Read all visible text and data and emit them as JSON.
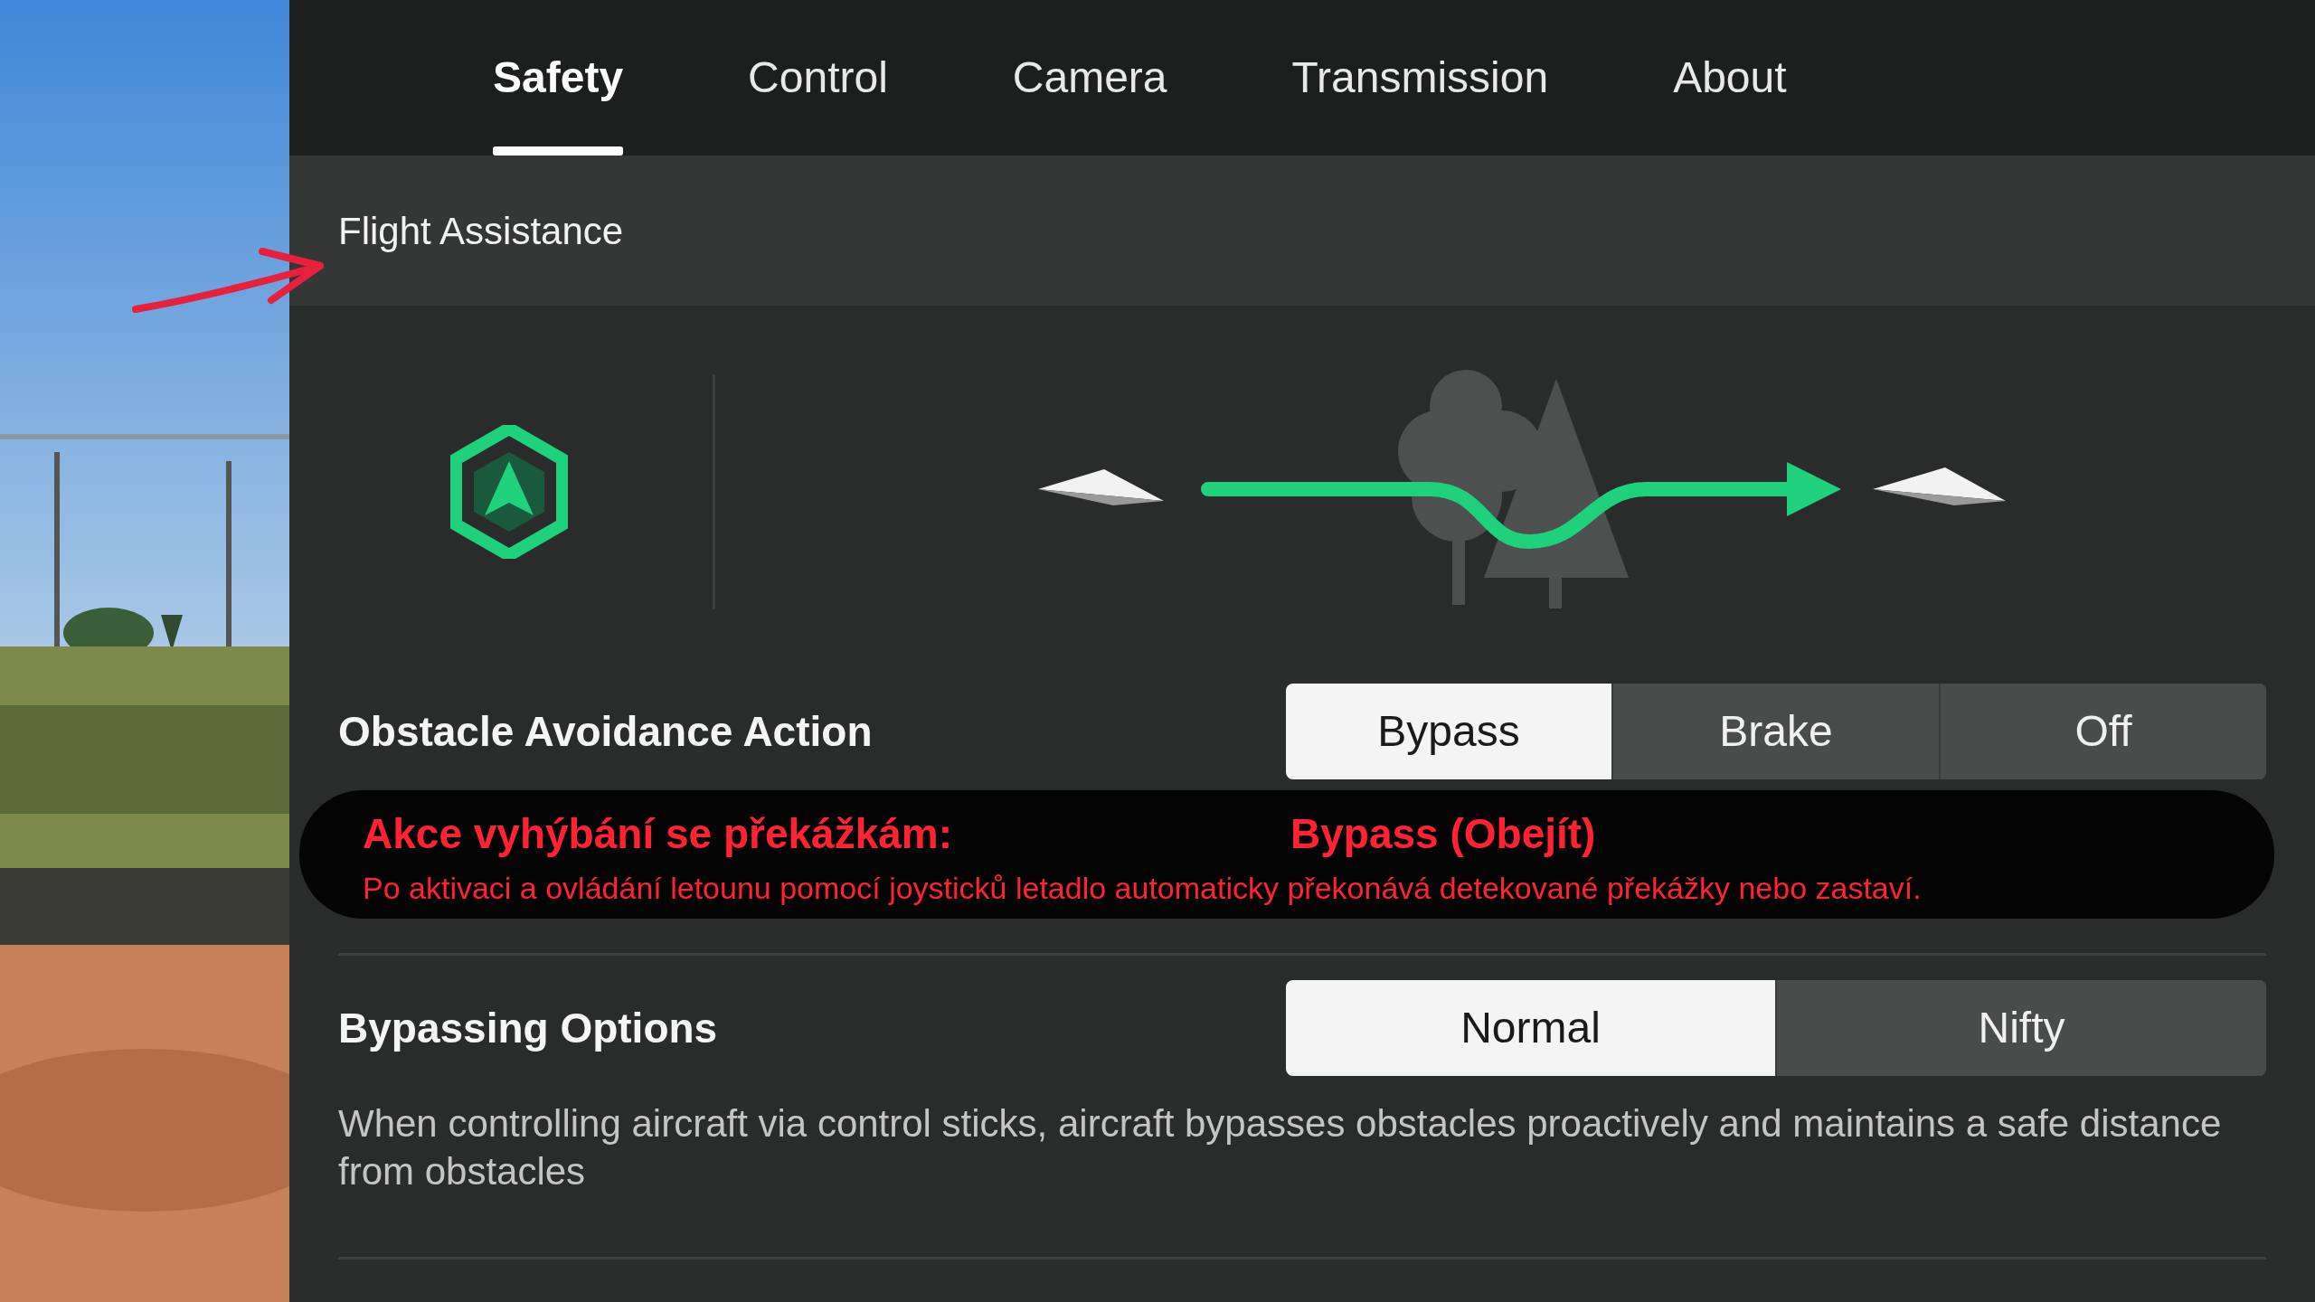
{
  "tabs": [
    {
      "label": "Safety",
      "selected": true
    },
    {
      "label": "Control",
      "selected": false
    },
    {
      "label": "Camera",
      "selected": false
    },
    {
      "label": "Transmission",
      "selected": false
    },
    {
      "label": "About",
      "selected": false
    }
  ],
  "section": {
    "title": "Flight Assistance"
  },
  "obstacle_avoidance": {
    "title": "Obstacle Avoidance Action",
    "options": [
      {
        "label": "Bypass",
        "selected": true
      },
      {
        "label": "Brake",
        "selected": false
      },
      {
        "label": "Off",
        "selected": false
      }
    ]
  },
  "annotation": {
    "heading": "Akce vyhýbání se překážkám:",
    "value": "Bypass (Obejít)",
    "text": "Po aktivaci a ovládání letounu pomocí joysticků letadlo automaticky překonává detekované překážky nebo zastaví."
  },
  "bypassing_options": {
    "title": "Bypassing Options",
    "options": [
      {
        "label": "Normal",
        "selected": true
      },
      {
        "label": "Nifty",
        "selected": false
      }
    ],
    "description": "When controlling aircraft via control sticks, aircraft bypasses obstacles proactively and maintains a safe distance from obstacles"
  }
}
